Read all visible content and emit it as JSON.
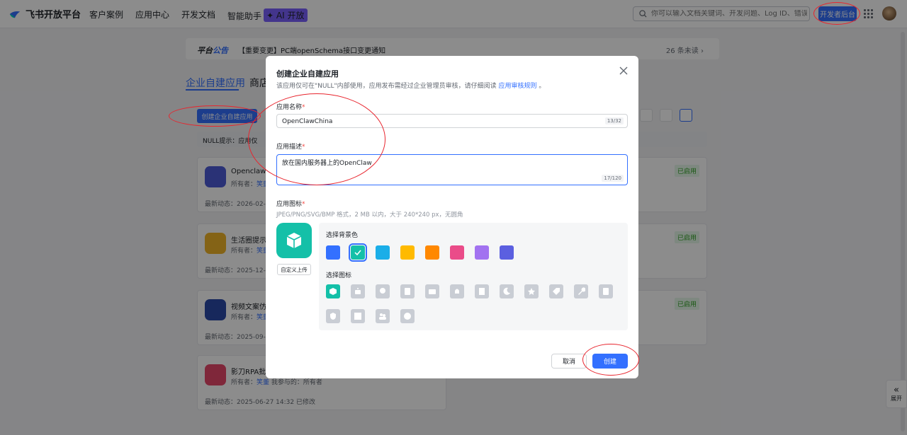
{
  "nav": {
    "logo_text": "飞书开放平台",
    "links": [
      "客户案例",
      "应用中心",
      "开发文档",
      "智能助手"
    ],
    "ai_badge": "✦ AI 开放",
    "search_placeholder": "你可以输入文档关键词、开发问题、Log ID、错误码",
    "dev_console": "开发者后台"
  },
  "notice": {
    "title_a": "平台",
    "title_b": "公告",
    "text": "【重要变更】PC端openSchema接口变更通知",
    "count": "26 条未读 ›"
  },
  "tabs": {
    "active": "企业自建应用",
    "other": "商店"
  },
  "bg": {
    "create_button": "创建企业自建应用",
    "tip": "NULL提示：应用仅",
    "apps": [
      {
        "name": "OpenclawT",
        "owner": "所有者：",
        "owner_name": "笑董",
        "date": "最新动态：2026-02-12",
        "status": "已启用",
        "color": "#4e5bd8"
      },
      {
        "name": "生活圈提示",
        "owner": "所有者：",
        "owner_name": "笑董",
        "date": "最新动态：2025-12-13",
        "status": "已启用",
        "color": "#f0b429"
      },
      {
        "name": "视频文案仿",
        "owner": "所有者：",
        "owner_name": "笑董",
        "date": "最新动态：2025-09-16",
        "status": "已启用",
        "color": "#2b4aa8"
      },
      {
        "name": "影刀RPA批",
        "owner": "所有者：",
        "owner_name": "笑董",
        "extra": "我参与的：所有者",
        "date": "最新动态：2025-06-27 14:32 已修改",
        "status": "",
        "color": "#e8476a"
      }
    ],
    "expand": "展开"
  },
  "modal": {
    "title": "创建企业自建应用",
    "subtitle": "该应用仅可在\"NULL\"内部使用，应用发布需经过企业管理员审核，请仔细阅读",
    "subtitle_link": "应用审核规则",
    "subtitle_end": "。",
    "name_label": "应用名称",
    "name_value": "OpenClawChina",
    "name_counter": "13/32",
    "desc_label": "应用描述",
    "desc_value": "放在国内服务器上的OpenClaw",
    "desc_counter": "17/120",
    "icon_label": "应用图标",
    "icon_hint": "JPEG/PNG/SVG/BMP 格式，2 MB 以内，大于 240*240 px，无圆角",
    "upload": "自定义上传",
    "bg_label": "选择背景色",
    "icon_pick_label": "选择图标",
    "colors": [
      "#3370ff",
      "#14c0a8",
      "#1aaee8",
      "#ffba00",
      "#ff8800",
      "#ea4c89",
      "#a272f0",
      "#5b5fe0"
    ],
    "selected_color_index": 1,
    "icons": [
      "cube-icon",
      "robot-icon",
      "pin-icon",
      "doc-icon",
      "box-icon",
      "bell-icon",
      "chart-icon",
      "moon-icon",
      "star-icon",
      "tag-icon",
      "wrench-icon",
      "file-icon",
      "shield-icon",
      "layout-icon",
      "people-icon",
      "compass-icon"
    ],
    "cancel": "取消",
    "create": "创建"
  }
}
